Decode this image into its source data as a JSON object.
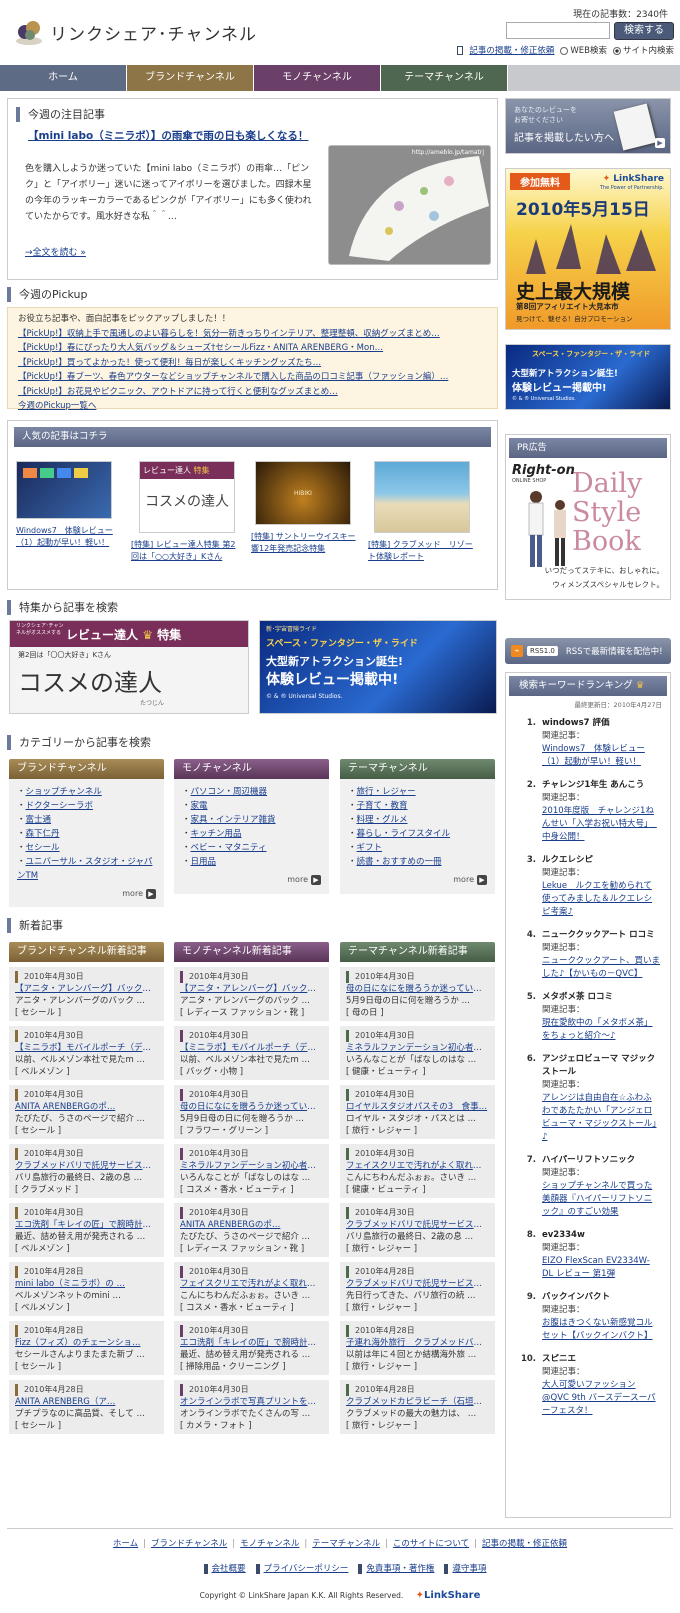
{
  "header": {
    "site_title": "リンクシェア･チャンネル",
    "article_count": "現在の記事数：2340件",
    "search_button": "検索する",
    "post_link": "記事の掲載・修正依頼",
    "radio_web": "WEB検索",
    "radio_site": "サイト内検索"
  },
  "nav": [
    "ホーム",
    "ブランドチャンネル",
    "モノチャンネル",
    "テーマチャンネル"
  ],
  "featured": {
    "section_title": "今週の注目記事",
    "headline": "【mini labo（ミニラボ）】の雨傘で雨の日も楽しくなる！",
    "body": "色を購入しようか迷っていた【mini labo（ミニラボ）の雨傘…「ピンク」と「アイボリー」迷いに迷ってアイボリーを選びました。四録木星の今年のラッキーカラーであるピンクが「アイボリー」にも多く使われていたからです。風水好きな私＾＾…",
    "read_more": "→全文を読む",
    "img_caption": "http://ameblo.jp/tamatrj"
  },
  "pickup": {
    "section_title": "今週のPickup",
    "intro": "お役立ち記事や、面白記事をピックアップしました！！",
    "items": [
      "【PickUp!】収納上手で風通しのよい暮らしを！気分一新きっちりインテリア、整理整頓、収納グッズまとめ…",
      "【PickUp!】春にぴったり大人気バッグ＆シューズ†セシールFizz・ANITA ARENBERG・Mon…",
      "【PickUp!】買ってよかった！使って便利！毎日が楽しくキッチングッズたち…",
      "【PickUp!】春ブーツ、春色アウターなどショップチャンネルで購入した商品の口コミ記事（ファッション編）…",
      "【PickUp!】お花見やピクニック、アウトドアに持って行くと便利なグッズまとめ…"
    ],
    "list_link": "今週のPickup一覧へ"
  },
  "popular": {
    "section_title": "人気の記事はコチラ",
    "items": [
      {
        "caption": "Windows7　体験レビュー（1）起動が早い！軽い！"
      },
      {
        "caption": "[特集] レビュー達人特集 第2回は「○○大好き」Kさん",
        "img_banner": "レビュー達人",
        "img_badge": "特集",
        "img_text": "コスメの達人"
      },
      {
        "caption": "[特集] サントリーウイスキー響12年発売記念特集",
        "img_label": "HIBIKI"
      },
      {
        "caption": "[特集] クラブメッド　リゾート体験レポート"
      }
    ]
  },
  "feature_search": {
    "section_title": "特集から記事を検索",
    "banner1_top": "リンクシェア･チャンネルがオススメする",
    "banner1_title": "レビュー達人",
    "banner1_badge": "特集",
    "banner1_sub": "第2回は「〇〇大好き」Kさん",
    "banner1_big": "コスメの達人",
    "banner1_ruby": "たつじん",
    "banner2_top": "新･宇宙冒険ライド",
    "banner2_title": "スペース・ファンタジー・ザ・ライド",
    "banner2_line1": "大型新アトラクション誕生!",
    "banner2_line2": "体験レビュー掲載中!",
    "banner2_copy": "© & ® Universal Studios."
  },
  "categories": {
    "section_title": "カテゴリーから記事を検索",
    "cols": [
      {
        "title": "ブランドチャンネル",
        "items": [
          "ショップチャンネル",
          "ドクターシーラボ",
          "富士通",
          "森下仁丹",
          "セシール",
          "ユニバーサル・スタジオ・ジャパンTM"
        ],
        "more": "more"
      },
      {
        "title": "モノチャンネル",
        "items": [
          "パソコン・周辺機器",
          "家電",
          "家具・インテリア雑貨",
          "キッチン用品",
          "ベビー・マタニティ",
          "日用品"
        ],
        "more": "more"
      },
      {
        "title": "テーマチャンネル",
        "items": [
          "旅行・レジャー",
          "子育て・教育",
          "料理・グルメ",
          "暮らし・ライフスタイル",
          "ギフト",
          "読書・おすすめの一冊"
        ],
        "more": "more"
      }
    ]
  },
  "new_articles": {
    "section_title": "新着記事",
    "cols": [
      {
        "title": "ブランドチャンネル新着記事",
        "cards": [
          {
            "date": "2010年4月30日",
            "title": "【アニタ・アレンバーグ】バックリ…",
            "desc": "アニタ・アレンバーグのバック …",
            "cat": "[ セシール ]"
          },
          {
            "date": "2010年4月30日",
            "title": "【ミニラボ】モバイルポーチ（デジ…",
            "desc": "以前、ベルメゾン本社で見たm …",
            "cat": "[ ベルメゾン ]"
          },
          {
            "date": "2010年4月30日",
            "title": "ANITA ARENBERGのポ…",
            "desc": "たびたび、うさのページで紹介 …",
            "cat": "[ セシール ]"
          },
          {
            "date": "2010年4月30日",
            "title": "クラブメッドバリで託児サービス利…",
            "desc": "バリ島旅行の最終日、2歳の息 …",
            "cat": "[ クラブメッド ]"
          },
          {
            "date": "2010年4月30日",
            "title": "エコ洗剤「キレイの匠」で腕時計の…",
            "desc": "最近、詰め替え用が発売される …",
            "cat": "[ ベルメゾン ]"
          },
          {
            "date": "2010年4月28日",
            "title": "mini labo（ミニラボ）の …",
            "desc": "ベルメゾンネットのmini …",
            "cat": "[ ベルメゾン ]"
          },
          {
            "date": "2010年4月28日",
            "title": "Fizz（フィズ）のチェーンショ…",
            "desc": "セシールさんよりまたまた新ブ …",
            "cat": "[ セシール ]"
          },
          {
            "date": "2010年4月28日",
            "title": "ANITA ARENBERG（ア…",
            "desc": "プチプラなのに高品質、そして …",
            "cat": "[ セシール ]"
          }
        ]
      },
      {
        "title": "モノチャンネル新着記事",
        "cards": [
          {
            "date": "2010年4月30日",
            "title": "【アニタ・アレンバーグ】バックリ…",
            "desc": "アニタ・アレンバーグのバック …",
            "cat": "[ レディース ファッション・靴 ]"
          },
          {
            "date": "2010年4月30日",
            "title": "【ミニラボ】モバイルポーチ（デジ…",
            "desc": "以前、ベルメゾン本社で見たm …",
            "cat": "[ バッグ・小物 ]"
          },
          {
            "date": "2010年4月30日",
            "title": "母の日になにを贈ろうか迷っている…",
            "desc": "5月9日母の日に何を贈ろうか …",
            "cat": "[ フラワー・グリーン ]"
          },
          {
            "date": "2010年4月30日",
            "title": "ミネラルファンデーション初心者は…",
            "desc": "いろんなことが「ばなしのはな …",
            "cat": "[ コスメ・香水・ビューティ ]"
          },
          {
            "date": "2010年4月30日",
            "title": "ANITA ARENBERGのポ…",
            "desc": "たびたび、うさのページで紹介 …",
            "cat": "[ レディース ファッション・靴 ]"
          },
          {
            "date": "2010年4月30日",
            "title": "フェイスクリエで汚れがよく取れる…",
            "desc": "こんにちわんだふぉぉ。さいき …",
            "cat": "[ コスメ・香水・ビューティ ]"
          },
          {
            "date": "2010年4月30日",
            "title": "エコ洗剤「キレイの匠」で腕時計の…",
            "desc": "最近、詰め替え用が発売される …",
            "cat": "[ 掃除用品・クリーニング ]"
          },
          {
            "date": "2010年4月30日",
            "title": "オンラインラボで写真プリントを大…",
            "desc": "オンラインラボでたくさんの写 …",
            "cat": "[ カメラ・フォト ]"
          }
        ]
      },
      {
        "title": "テーマチャンネル新着記事",
        "cards": [
          {
            "date": "2010年4月30日",
            "title": "母の日になにを贈ろうか迷っている…",
            "desc": "5月9日母の日に何を贈ろうか …",
            "cat": "[ 母の日 ]"
          },
          {
            "date": "2010年4月30日",
            "title": "ミネラルファンデーション初心者は…",
            "desc": "いろんなことが「ばなしのはな …",
            "cat": "[ 健康・ビューティ ]"
          },
          {
            "date": "2010年4月30日",
            "title": "ロイヤルスタジオパスその3　食事…",
            "desc": "ロイヤル・スタジオ・パスとは …",
            "cat": "[ 旅行・レジャー ]"
          },
          {
            "date": "2010年4月30日",
            "title": "フェイスクリエで汚れがよく取れる…",
            "desc": "こんにちわんだふぉぉ。さいき …",
            "cat": "[ 健康・ビューティ ]"
          },
          {
            "date": "2010年4月30日",
            "title": "クラブメッドバリで託児サービス利…",
            "desc": "バリ島旅行の最終日、2歳の息 …",
            "cat": "[ 旅行・レジャー ]"
          },
          {
            "date": "2010年4月28日",
            "title": "クラブメッドバリで託児サービス利…",
            "desc": "先日行ってきた、バリ旅行の続 …",
            "cat": "[ 旅行・レジャー ]"
          },
          {
            "date": "2010年4月28日",
            "title": "子連れ海外旅行　クラブメッドバリ…",
            "desc": "以前は年に４回とか結構海外旅 …",
            "cat": "[ 旅行・レジャー ]"
          },
          {
            "date": "2010年4月28日",
            "title": "クラブメッドカピラビーチ（石垣島…",
            "desc": "クラブメッドの最大の魅力は、 …",
            "cat": "[ 旅行・レジャー ]"
          }
        ]
      }
    ]
  },
  "sidebar": {
    "review_banner_small1": "あなたのレビューを",
    "review_banner_small2": "お寄せください",
    "review_banner": "記事を掲載したい方へ",
    "ad1_free": "参加無料",
    "ad1_brand": "LinkShare",
    "ad1_brand_sub": "The Power of Partnership.",
    "ad1_date": "2010年5月15日",
    "ad1_big": "史上最大規模",
    "ad1_sub": "第8回アフィリエイト大見本市",
    "ad1_sub2": "見つけて、魅せる！自分プロモーション",
    "ad2_title": "スペース・ファンタジー・ザ・ライド",
    "ad2_line1": "大型新アトラクション誕生!",
    "ad2_line2": "体験レビュー掲載中!",
    "ad2_copy": "© & ® Universal Studios.",
    "pr_title": "PR広告",
    "pr_brand": "Right-on",
    "pr_brand_sub": "ONLINE SHOP",
    "pr_big1": "Daily",
    "pr_big2": "Style",
    "pr_big3": "Book",
    "pr_text1": "いつだってステキに、おしゃれに。",
    "pr_text2": "ウィメンズスペシャルセレクト。",
    "rss_badge": "RSS1.0",
    "rss_text": "RSSで最新情報を配信中!",
    "ranking_title": "検索キーワードランキング",
    "ranking_updated": "最終更新日：2010年4月27日",
    "related_label": "関連記事：",
    "ranking": [
      {
        "num": "1.",
        "kw": "windows7 評価",
        "link": "Windows7　体験レビュー（1）起動が早い！軽い！"
      },
      {
        "num": "2.",
        "kw": "チャレンジ1年生 あんこう",
        "link": "2010年度版　チャレンジ1ねんせい「入学お祝い特大号」　中身公開！"
      },
      {
        "num": "3.",
        "kw": "ルクエレシピ",
        "link": "Lekue　ルクエを勧められて使ってみました＆ルクエレシピ考案♪"
      },
      {
        "num": "4.",
        "kw": "ニューククックアート ロコミ",
        "link": "ニューククックアート、買いました♪【かいもの－QVC】"
      },
      {
        "num": "5.",
        "kw": "メタボメ茶 ロコミ",
        "link": "現在愛飲中の「メタボメ茶」をちょっと紹介～♪"
      },
      {
        "num": "6.",
        "kw": "アンジェロビューマ マジックストール",
        "link": "アレンジは自由自在☆ふわふわであたたかい「アンジェロビューマ・マジックストール」♪"
      },
      {
        "num": "7.",
        "kw": "ハイパーリフトソニック",
        "link": "ショップチャンネルで買った美顔器『ハイパーリフトソニック』のすごい効果"
      },
      {
        "num": "8.",
        "kw": "ev2334w",
        "link": "EIZO FlexScan EV2334W-DL レビュー 第1弾"
      },
      {
        "num": "9.",
        "kw": "バックインバクト",
        "link": "お腹はきつくない新感覚コルセット【バックインバクト】"
      },
      {
        "num": "10.",
        "kw": "スピニエ",
        "link": "大人可愛いファッション@QVC 9th バースデースーパーフェスタ！"
      }
    ]
  },
  "footer": {
    "links": [
      "ホーム",
      "ブランドチャンネル",
      "モノチャンネル",
      "テーマチャンネル",
      "このサイトについて",
      "記事の掲載・修正依頼"
    ],
    "links2": [
      "会社概要",
      "プライバシーポリシー",
      "免責事項・著作権",
      "遵守事項"
    ],
    "copyright": "Copyright © LinkShare Japan K.K. All Rights Reserved.",
    "logo": "LinkShare",
    "logo_sub": "The Power of Partnership."
  },
  "colors": {
    "nav_home": "#5e6b85",
    "nav_brand": "#8e7548",
    "nav_mono": "#6a3f68",
    "nav_theme": "#4f6651"
  }
}
